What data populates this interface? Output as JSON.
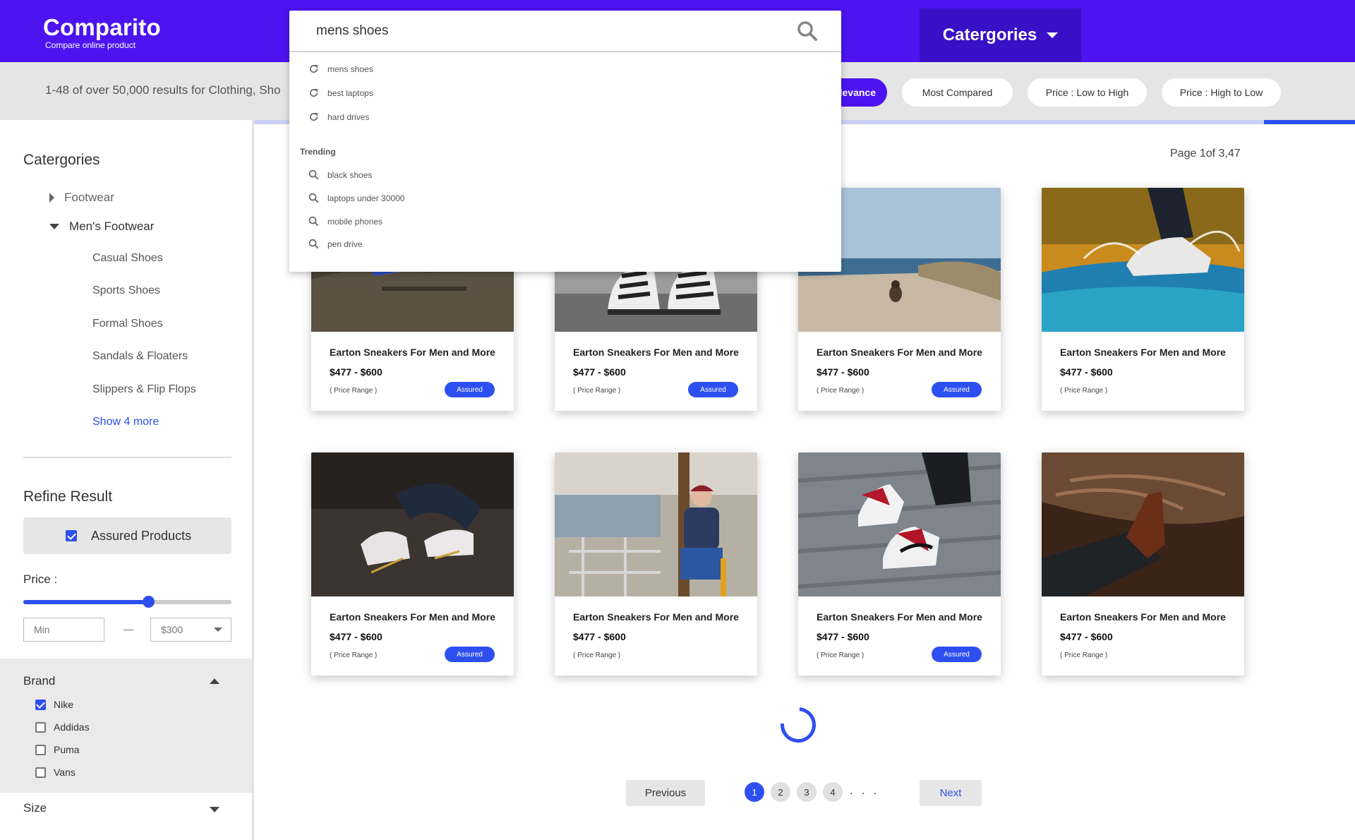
{
  "header": {
    "logo_title": "Comparito",
    "logo_tagline": "Compare online product",
    "categories_button": "Catergories"
  },
  "search": {
    "value": "mens shoes",
    "recent": [
      "mens shoes",
      "best laptops",
      "hard drives"
    ],
    "trending_label": "Trending",
    "trending": [
      "black shoes",
      "laptops under 30000",
      "mobile phones",
      "pen drive"
    ]
  },
  "results_bar": {
    "summary": "1-48 of over 50,000 results for Clothing, Sho",
    "sort_options": [
      "Relevance",
      "Most Compared",
      "Price : Low to High",
      "Price : High to Low"
    ],
    "active_sort_visible_text": "levance"
  },
  "sidebar": {
    "categories_title": "Catergories",
    "tree": [
      {
        "label": "Footwear",
        "expanded": false
      },
      {
        "label": "Men's Footwear",
        "expanded": true
      }
    ],
    "subcategories": [
      "Casual Shoes",
      "Sports Shoes",
      "Formal Shoes",
      "Sandals & Floaters",
      "Slippers & Flip Flops"
    ],
    "show_more": "Show 4 more",
    "refine_title": "Refine Result",
    "assured_label": "Assured Products",
    "assured_checked": true,
    "price_label": "Price :",
    "price_slider_level": 0.6,
    "price_min_placeholder": "Min",
    "price_max_value": "$300",
    "brand_title": "Brand",
    "brands": [
      {
        "label": "Nike",
        "checked": true
      },
      {
        "label": "Addidas",
        "checked": false
      },
      {
        "label": "Puma",
        "checked": false
      },
      {
        "label": "Vans",
        "checked": false
      }
    ],
    "size_title": "Size"
  },
  "products": {
    "page_info": "Page 1of 3,47",
    "items": [
      {
        "title": "Earton Sneakers For Men and More",
        "price": "$477 - $600",
        "range_label": "( Price Range )",
        "badge": "Assured",
        "image": "sneaker-on-rock"
      },
      {
        "title": "Earton Sneakers For Men and More",
        "price": "$477 - $600",
        "range_label": "( Price Range )",
        "badge": "Assured",
        "image": "striped-sneakers"
      },
      {
        "title": "Earton Sneakers For Men and More",
        "price": "$477 - $600",
        "range_label": "( Price Range )",
        "badge": "Assured",
        "image": "beach-dog"
      },
      {
        "title": "Earton Sneakers For Men and More",
        "price": "$477 - $600",
        "range_label": "( Price Range )",
        "badge": "",
        "image": "splash-sneaker"
      },
      {
        "title": "Earton Sneakers For Men and More",
        "price": "$477 - $600",
        "range_label": "( Price Range )",
        "badge": "Assured",
        "image": "lacing-sneakers"
      },
      {
        "title": "Earton Sneakers For Men and More",
        "price": "$477 - $600",
        "range_label": "( Price Range )",
        "badge": "",
        "image": "man-sitting-station"
      },
      {
        "title": "Earton Sneakers For Men and More",
        "price": "$477 - $600",
        "range_label": "( Price Range )",
        "badge": "Assured",
        "image": "red-high-tops"
      },
      {
        "title": "Earton Sneakers For Men and More",
        "price": "$477 - $600",
        "range_label": "( Price Range )",
        "badge": "",
        "image": "brown-dress-shoe"
      }
    ]
  },
  "pagination": {
    "previous": "Previous",
    "next": "Next",
    "pages": [
      "1",
      "2",
      "3",
      "4"
    ],
    "current": "1",
    "ellipsis": ". . ."
  },
  "colors": {
    "brand": "#4c14f0",
    "accent": "#2e4ff0",
    "header_button": "#3a10c6"
  }
}
